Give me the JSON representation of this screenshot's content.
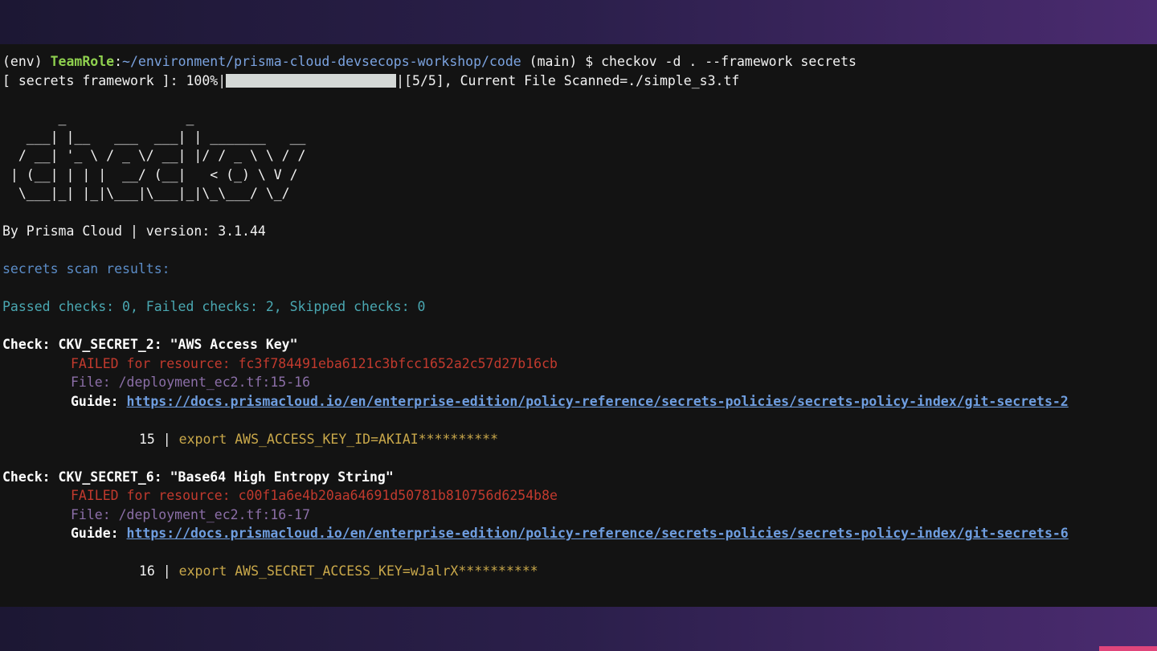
{
  "command_line": {
    "env": "(env) ",
    "user": "TeamRole",
    "sep": ":",
    "path": "~/environment/prisma-cloud-devsecops-workshop/code",
    "branch_and_cmd": " (main) $ checkov -d . --framework secrets"
  },
  "progress": {
    "prefix": "[ secrets framework ]: 100%|",
    "percent": 100,
    "suffix": "|[5/5], Current File Scanned=./simple_s3.tf"
  },
  "banner": {
    "ascii_art": "       _               _\n   ___| |__   ___  ___| | _______   __\n  / __| '_ \\ / _ \\/ __| |/ / _ \\ \\ / /\n | (__| | | |  __/ (__|   < (_) \\ V /\n  \\___|_| |_|\\___|\\___|_|\\_\\___/ \\_/",
    "byline": "By Prisma Cloud | version: 3.1.44"
  },
  "results": {
    "heading": "secrets scan results:",
    "summary": "Passed checks: 0, Failed checks: 2, Skipped checks: 0"
  },
  "checks": [
    {
      "title": "Check: CKV_SECRET_2: \"AWS Access Key\"",
      "failed": "FAILED for resource: fc3f784491eba6121c3bfcc1652a2c57d27b16cb",
      "file": "File: /deployment_ec2.tf:15-16",
      "guide_label": "Guide: ",
      "guide_url": "https://docs.prismacloud.io/en/enterprise-edition/policy-reference/secrets-policies/secrets-policy-index/git-secrets-2",
      "code_line_no": "15 | ",
      "code": "export AWS_ACCESS_KEY_ID=AKIAI**********"
    },
    {
      "title": "Check: CKV_SECRET_6: \"Base64 High Entropy String\"",
      "failed": "FAILED for resource: c00f1a6e4b20aa64691d50781b810756d6254b8e",
      "file": "File: /deployment_ec2.tf:16-17",
      "guide_label": "Guide: ",
      "guide_url": "https://docs.prismacloud.io/en/enterprise-edition/policy-reference/secrets-policies/secrets-policy-index/git-secrets-6",
      "code_line_no": "16 | ",
      "code": "export AWS_SECRET_ACCESS_KEY=wJalrX**********"
    }
  ],
  "colors": {
    "background": "#131313",
    "prompt_user": "#8fd14f",
    "path": "#7ba3e0",
    "failed": "#c23a2e",
    "file": "#8c6fa8",
    "link": "#6f9ee0",
    "code": "#c9a84a",
    "summary": "#4aa8b2",
    "frame_accent": "#e0457b"
  }
}
